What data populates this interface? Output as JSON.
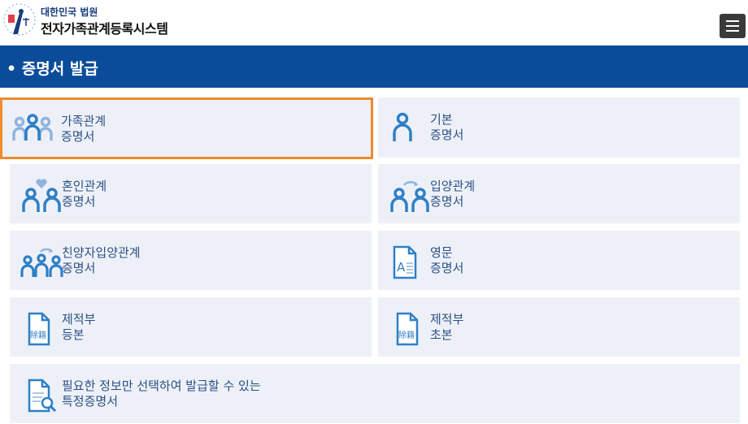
{
  "header": {
    "court": "대한민국 법원",
    "system": "전자가족관계등록시스템",
    "menu_icon": "hamburger-menu-icon"
  },
  "page_title": "• 증명서 발급",
  "tiles": [
    {
      "line1": "가족관계",
      "line2": "증명서",
      "icon": "family-icon",
      "selected": true
    },
    {
      "line1": "기본",
      "line2": "증명서",
      "icon": "person-icon"
    },
    {
      "line1": "혼인관계",
      "line2": "증명서",
      "icon": "couple-heart-icon"
    },
    {
      "line1": "입양관계",
      "line2": "증명서",
      "icon": "adoption-icon"
    },
    {
      "line1": "친양자입양관계",
      "line2": "증명서",
      "icon": "full-adoption-icon"
    },
    {
      "line1": "영문",
      "line2": "증명서",
      "icon": "english-document-icon"
    },
    {
      "line1": "제적부",
      "line2": "등본",
      "icon": "removal-register-icon",
      "icon_text": "除籍"
    },
    {
      "line1": "제적부",
      "line2": "초본",
      "icon": "removal-register-icon",
      "icon_text": "除籍"
    },
    {
      "line1": "필요한 정보만 선택하여 발급할 수 있는",
      "line2": "특정증명서",
      "icon": "document-search-icon"
    }
  ],
  "colors": {
    "accent": "#0a4c99",
    "selected_border": "#f08a2b",
    "tile_bg": "#edf1f7",
    "icon_blue": "#2f7fc6"
  }
}
